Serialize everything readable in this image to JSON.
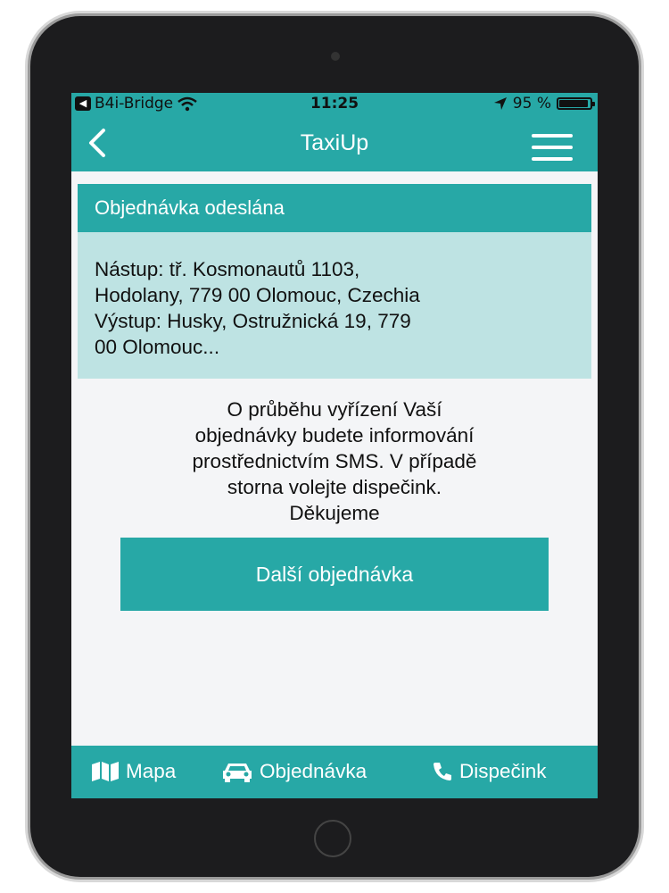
{
  "status_bar": {
    "app_back": "B4i-Bridge",
    "time": "11:25",
    "battery_percent": "95 %",
    "battery_level": 0.95
  },
  "nav": {
    "title": "TaxiUp"
  },
  "order": {
    "header": "Objednávka odeslána",
    "pickup_line1": "Nástup: tř. Kosmonautů 1103,",
    "pickup_line2": "Hodolany, 779 00 Olomouc, Czechia",
    "dropoff_line1": "Výstup: Husky, Ostružnická 19, 779",
    "dropoff_line2": "00 Olomouc..."
  },
  "info": {
    "line1": "O průběhu vyřízení Vaší",
    "line2": "objednávky budete informování",
    "line3": "prostřednictvím SMS. V případě",
    "line4": "storna volejte dispečink.",
    "line5": "Děkujeme"
  },
  "actions": {
    "next_order": "Další objednávka"
  },
  "tabs": [
    {
      "label": "Mapa",
      "icon": "map-icon"
    },
    {
      "label": "Objednávka",
      "icon": "car-icon"
    },
    {
      "label": "Dispečink",
      "icon": "phone-icon"
    }
  ],
  "colors": {
    "accent": "#27a8a6",
    "card_body": "#bee3e3",
    "background": "#f4f5f7"
  }
}
